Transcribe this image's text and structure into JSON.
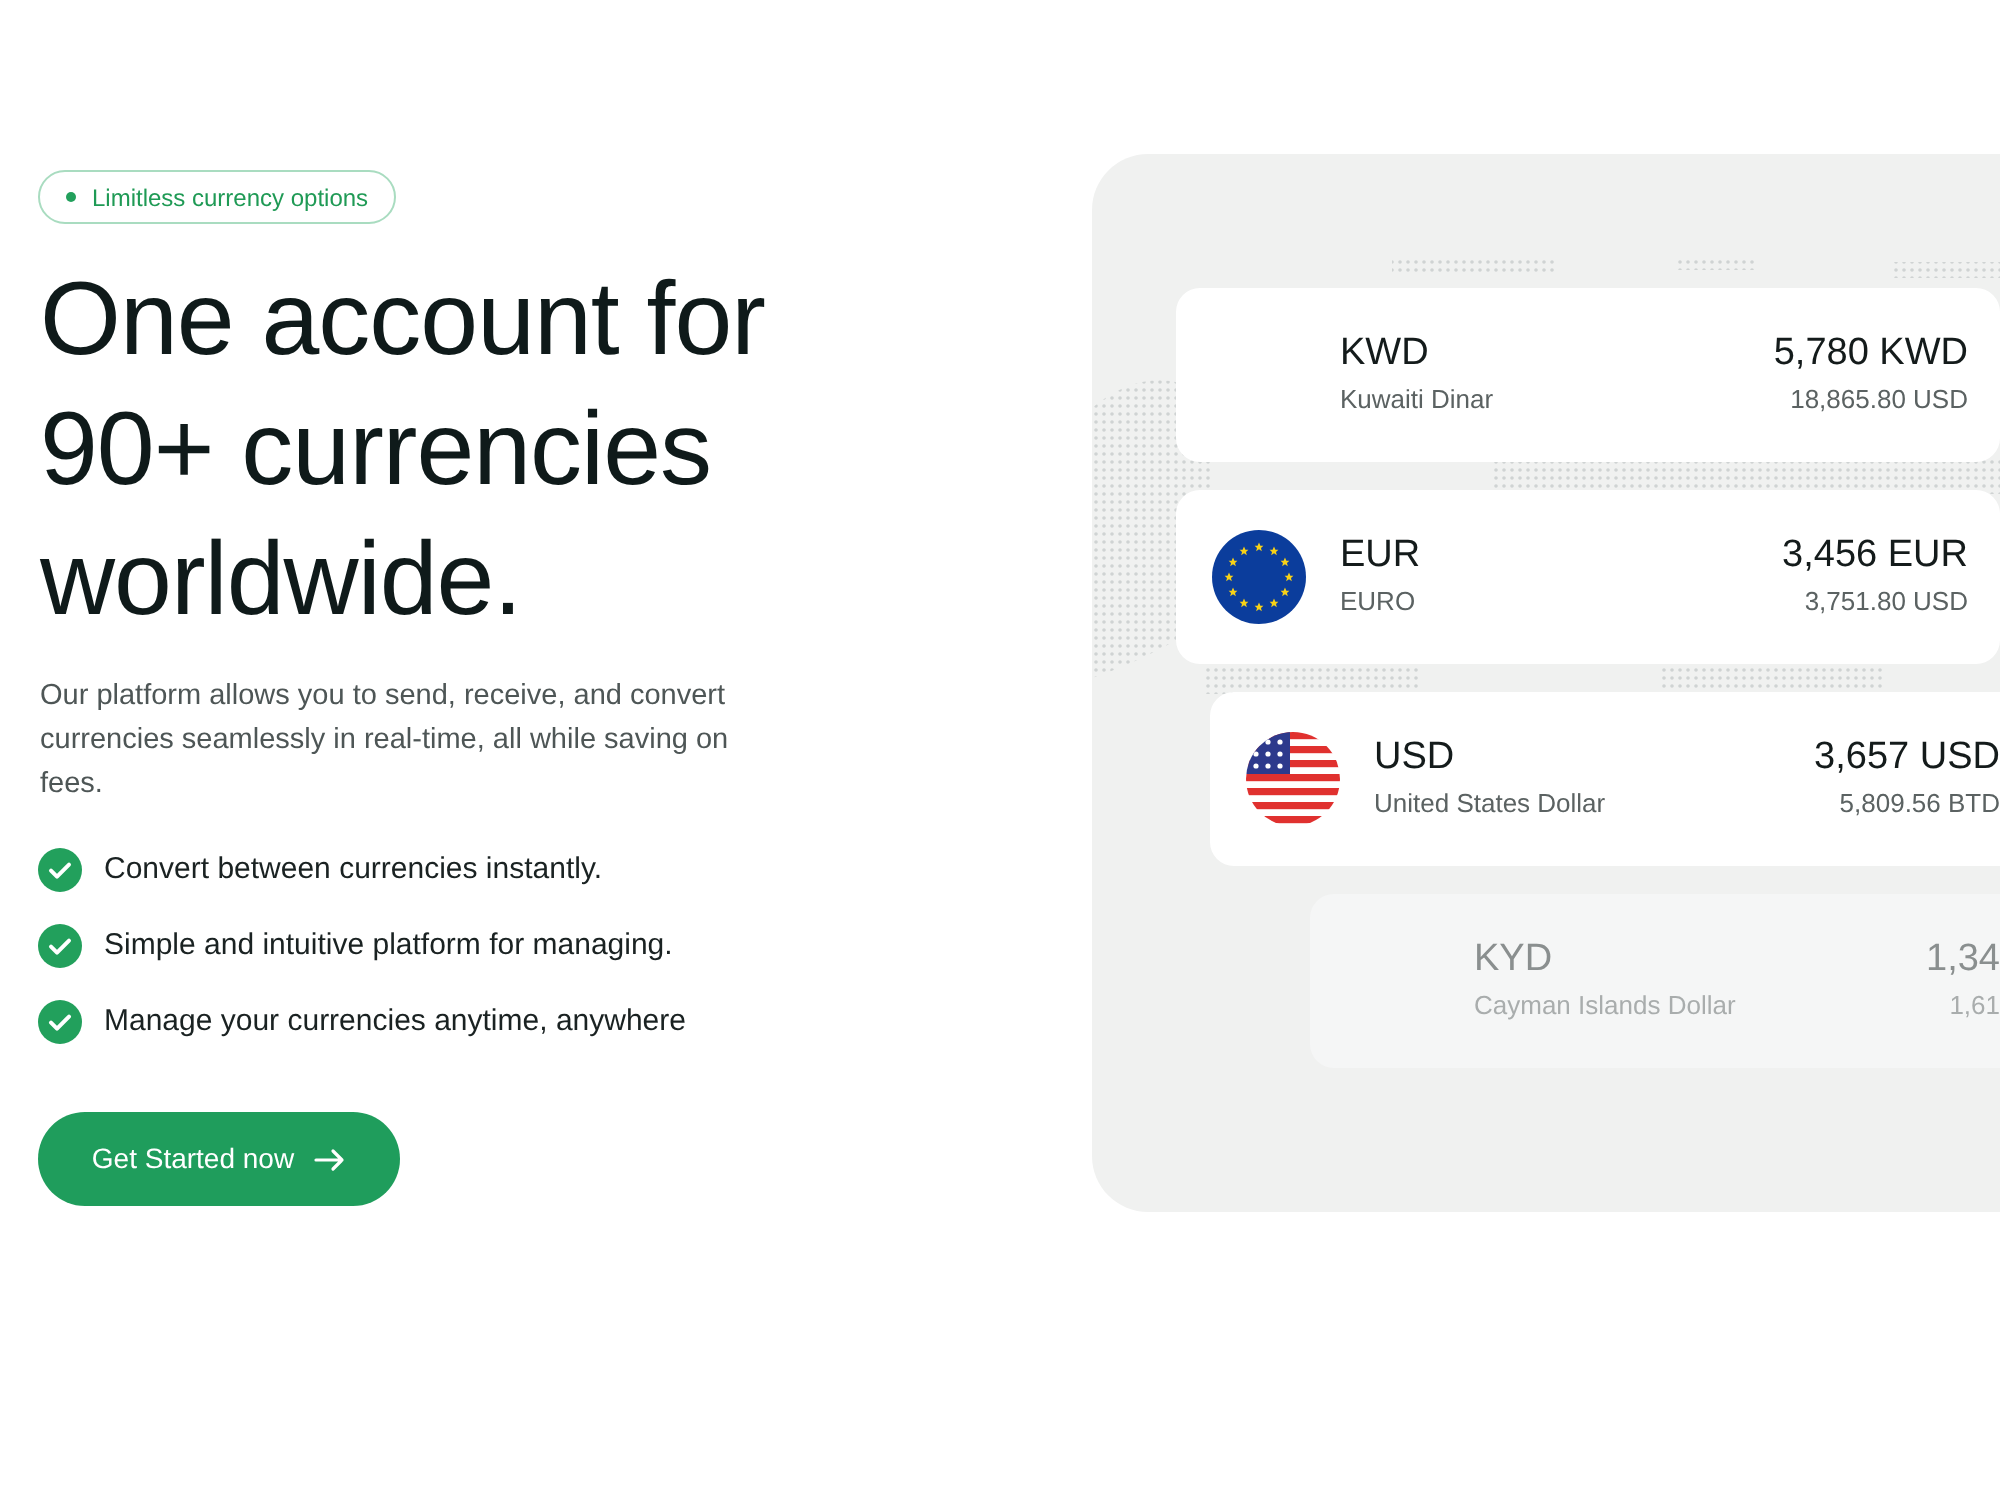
{
  "badge": {
    "text": "Limitless currency options"
  },
  "headline": "One account for 90+ currencies worldwide.",
  "description": "Our platform allows you to send, receive, and convert currencies seamlessly in real-time, all while saving on fees.",
  "features": [
    "Convert between currencies instantly.",
    "Simple and intuitive platform for managing.",
    "Manage your currencies anytime, anywhere"
  ],
  "cta_button": {
    "label": "Get Started now"
  },
  "currency_cards": [
    {
      "kind": "plain",
      "code": "KWD",
      "name": "Kuwaiti Dinar",
      "amount": "5,780 KWD",
      "converted": "18,865.80 USD",
      "dimmed": false
    },
    {
      "kind": "eu_flag",
      "code": "EUR",
      "name": "EURO",
      "amount": "3,456 EUR",
      "converted": "3,751.80 USD",
      "dimmed": false
    },
    {
      "kind": "us_flag",
      "code": "USD",
      "name": "United States Dollar",
      "amount": "3,657 USD",
      "converted": "5,809.56 BTD",
      "dimmed": false
    },
    {
      "kind": "plain",
      "code": "KYD",
      "name": "Cayman Islands Dollar",
      "amount": "1,34",
      "converted": "1,61",
      "dimmed": true
    }
  ]
}
